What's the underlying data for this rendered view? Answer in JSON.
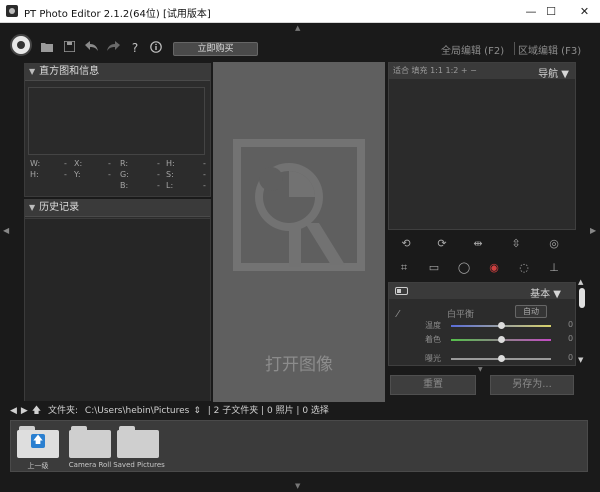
{
  "window": {
    "title": "PT Photo Editor 2.1.2(64位) [试用版本]",
    "min_glyph": "—",
    "max_glyph": "☐",
    "close_glyph": "✕"
  },
  "toolbar": {
    "buy_label": "立即购买",
    "tab_global": "全局编辑 (F2)",
    "tab_region": "区域编辑 (F3)",
    "icons": [
      "open-folder-icon",
      "save-icon",
      "undo-icon",
      "redo-icon",
      "help-icon",
      "info-icon"
    ]
  },
  "histogram": {
    "title": "直方图和信息",
    "rows": [
      [
        {
          "k": "W:",
          "v": "-"
        },
        {
          "k": "X:",
          "v": "-"
        },
        {
          "k": "R:",
          "v": "-"
        },
        {
          "k": "H:",
          "v": "-"
        }
      ],
      [
        {
          "k": "H:",
          "v": "-"
        },
        {
          "k": "Y:",
          "v": "-"
        },
        {
          "k": "G:",
          "v": "-"
        },
        {
          "k": "S:",
          "v": "-"
        }
      ],
      [
        {
          "k": "B:",
          "v": "-"
        },
        {
          "k": "L:",
          "v": "-"
        }
      ]
    ]
  },
  "history": {
    "title": "历史记录"
  },
  "canvas": {
    "label": "打开图像"
  },
  "navigator": {
    "zoom_text": "适合 填充 1:1 1:2 + −",
    "title": "导航"
  },
  "basic": {
    "title": "基本",
    "white_balance": "白平衡",
    "auto": "自动",
    "sliders": [
      {
        "label": "温度",
        "value": "0",
        "level": 0.5
      },
      {
        "label": "着色",
        "value": "0",
        "level": 0.5
      },
      {
        "label": "曝光",
        "value": "0",
        "level": 0.5
      }
    ]
  },
  "actions": {
    "reset": "重置",
    "save_as": "另存为..."
  },
  "browser": {
    "folder_label": "文件夹:",
    "path": "C:\\Users\\hebin\\Pictures",
    "summary": "| 2 子文件夹 | 0 照片 | 0 选择",
    "items": [
      {
        "label": "上一级",
        "type": "up"
      },
      {
        "label": "Camera Roll",
        "type": "folder"
      },
      {
        "label": "Saved Pictures",
        "type": "folder"
      }
    ]
  },
  "colors": {
    "accent_blue": "#2a7fd0",
    "temp_gradient_start": "#5a6dd8",
    "temp_gradient_end": "#d8d26a",
    "tint_gradient_start": "#54c04a",
    "tint_gradient_end": "#c44ac4"
  }
}
